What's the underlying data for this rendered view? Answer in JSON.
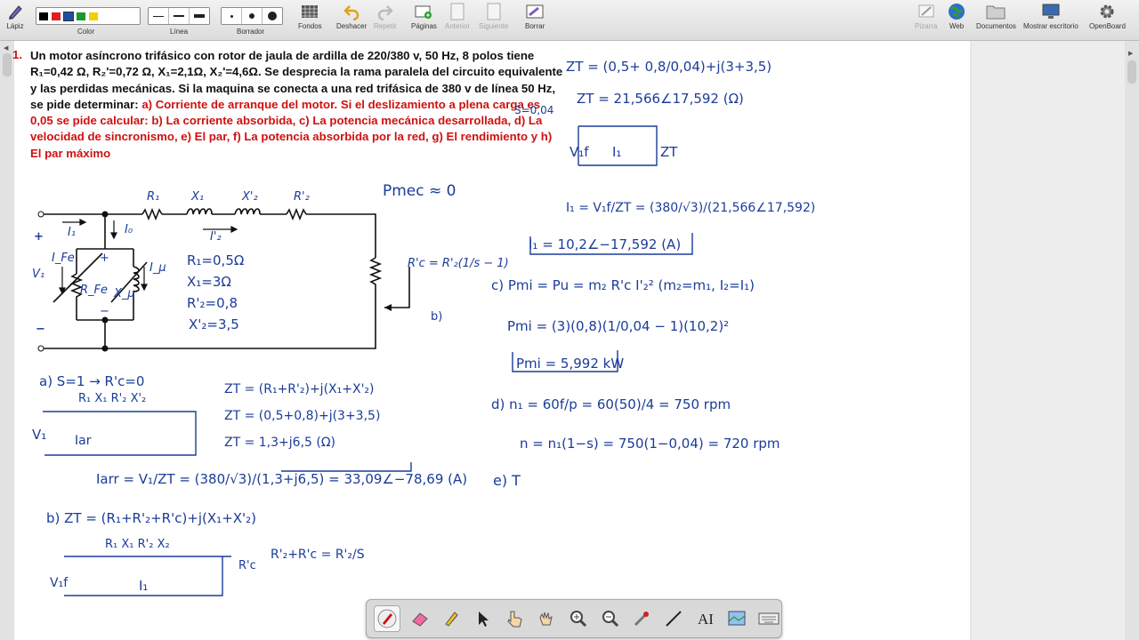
{
  "toolbar": {
    "pen_label": "Lápiz",
    "color_label": "Color",
    "line_label": "Línea",
    "eraser_label": "Borrador",
    "backgrounds_label": "Fondos",
    "undo_label": "Deshacer",
    "redo_label": "Repetir",
    "pages_label": "Páginas",
    "previous_label": "Anterior",
    "next_label": "Siguiente",
    "clear_label": "Borrar",
    "whiteboard_label": "Pizarra",
    "web_label": "Web",
    "documents_label": "Documentos",
    "desktop_label": "Mostrar escritorio",
    "openboard_label": "OpenBoard",
    "colors": [
      "#000000",
      "#e02020",
      "#1f4fa0",
      "#1a9a2a",
      "#f0d000"
    ]
  },
  "problem": {
    "number": "1.",
    "text_black": "Un motor asíncrono trifásico con rotor de jaula de ardilla de 220/380 v, 50 Hz, 8 polos tiene R₁=0,42 Ω, R₂'=0,72 Ω, X₁=2,1Ω, X₂'=4,6Ω. Se desprecia la rama paralela del circuito equivalente y las perdidas mecánicas. Si la maquina se conecta a una red trifásica de 380 v de línea 50 Hz, se pide determinar: ",
    "text_red": "a) Corriente de arranque del motor. Si el deslizamiento a plena carga es 0,05 se pide calcular: b) La corriente absorbida, c) La potencia mecánica desarrollada, d) La velocidad de sincronismo, e) El par, f) La potencia absorbida por la red, g) El rendimiento y h) El par máximo"
  },
  "circuit": {
    "R1": "R₁",
    "X1": "X₁",
    "X2": "X'₂",
    "R2": "R'₂",
    "I1": "I₁",
    "I0": "I₀",
    "I2": "I'₂",
    "IFe": "I_Fe",
    "Imu": "I_μ",
    "RFe": "R_Fe",
    "Xmu": "X_μ",
    "V1": "V₁",
    "plus": "+",
    "minus": "−",
    "Rc": "R'c = R'₂(1/s − 1)",
    "fig": "b)"
  },
  "handwriting": {
    "pmec": "Pmec ≈ 0",
    "s_value": "S=0,04",
    "values": [
      "R₁=0,5Ω",
      "X₁=3Ω",
      "R'₂=0,8",
      "X'₂=3,5"
    ],
    "a_line1": "a) S=1 → R'c=0",
    "a_labels": "R₁   X₁   R'₂  X'₂",
    "a_zt1": "ZT = (R₁+R'₂)+j(X₁+X'₂)",
    "a_zt2": "ZT = (0,5+0,8)+j(3+3,5)",
    "a_zt3": "ZT = 1,3+j6,5 (Ω)",
    "a_v1": "V₁",
    "a_iarr_small": "Iar",
    "a_iarr": "Iarr = V₁/ZT = (380/√3)/(1,3+j6,5) = 33,09∠−78,69 (A)",
    "b_zt": "b) ZT = (R₁+R'₂+R'c)+j(X₁+X'₂)",
    "b_labels": "R₁   X₁      R'₂    X₂",
    "b_v1": "V₁f",
    "b_i1": "I₁",
    "b_rc": "R'c",
    "b_eq": "R'₂+R'c = R'₂/S",
    "r_zt1": "ZT = (0,5+ 0,8/0,04)+j(3+3,5)",
    "r_zt2": "ZT = 21,566∠17,592 (Ω)",
    "r_v1": "V₁f",
    "r_i1c": "I₁",
    "r_ztc": "ZT",
    "r_i1": "I₁ = V₁f/ZT = (380/√3)/(21,566∠17,592)",
    "r_i1res": "I₁ = 10,2∠−17,592 (A)",
    "c_line": "c) Pmi = Pu = m₂ R'c I'₂²   (m₂=m₁, I₂=I₁)",
    "c_calc": "Pmi = (3)(0,8)(1/0,04 − 1)(10,2)²",
    "c_res": "Pmi = 5,992 kW",
    "d_line": "d) n₁ = 60f/p = 60(50)/4 = 750 rpm",
    "d_n": "n = n₁(1−s) = 750(1−0,04) = 720 rpm",
    "e_line": "e) T"
  },
  "bottom_tools": [
    "pen-tool",
    "eraser-tool",
    "marker-tool",
    "pointer-tool",
    "hand-pointer-tool",
    "grab-tool",
    "zoom-in-tool",
    "zoom-out-tool",
    "laser-tool",
    "line-tool",
    "text-tool",
    "capture-tool",
    "keyboard-tool"
  ]
}
